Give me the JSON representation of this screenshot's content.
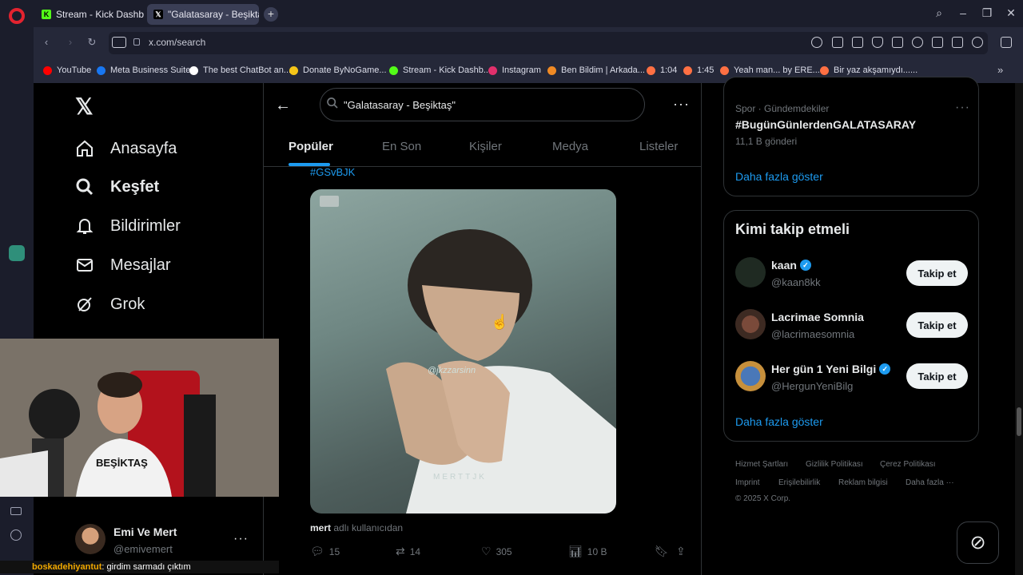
{
  "browser": {
    "tabs": [
      {
        "label": "Stream - Kick Dashboard",
        "icon": "kick-icon"
      },
      {
        "label": "\"Galatasaray - Beşiktaş",
        "icon": "x-icon"
      }
    ],
    "url": "x.com/search",
    "bookmarks": [
      {
        "label": "YouTube",
        "color": "#ff0000"
      },
      {
        "label": "Meta Business Suite",
        "color": "#1877f2"
      },
      {
        "label": "The best ChatBot an...",
        "color": "#ffffff"
      },
      {
        "label": "Donate ByNoGame...",
        "color": "#f5c518"
      },
      {
        "label": "Stream - Kick Dashb...",
        "color": "#53fc18"
      },
      {
        "label": "Instagram",
        "color": "#e1306c"
      },
      {
        "label": "Ben Bildim | Arkada...",
        "color": "#f08a24"
      },
      {
        "label": "1:04",
        "color": "#ff7043"
      },
      {
        "label": "1:45",
        "color": "#ff7043"
      },
      {
        "label": "Yeah man... by ERE...",
        "color": "#ff7043"
      },
      {
        "label": "Bir yaz akşamıydı......",
        "color": "#ff7043"
      }
    ]
  },
  "nav": {
    "items": [
      {
        "label": "Anasayfa",
        "icon": "home-icon"
      },
      {
        "label": "Keşfet",
        "icon": "search-icon"
      },
      {
        "label": "Bildirimler",
        "icon": "bell-icon"
      },
      {
        "label": "Mesajlar",
        "icon": "mail-icon"
      },
      {
        "label": "Grok",
        "icon": "grok-icon"
      }
    ]
  },
  "search": {
    "query": "\"Galatasaray - Beşiktaş\"",
    "tabs": [
      "Popüler",
      "En Son",
      "Kişiler",
      "Medya",
      "Listeler"
    ]
  },
  "post": {
    "hashtag": "#GSvBJK",
    "media_watermark": "MERTTJK",
    "media_tag": "@jkzzarsinn",
    "source_user": "mert",
    "source_suffix": "adlı kullanıcıdan",
    "replies": "15",
    "reposts": "14",
    "likes": "305",
    "views": "10 B"
  },
  "trend": {
    "category": "Spor · Gündemdekiler",
    "name": "#BugünGünlerdenGALATASARAY",
    "count": "11,1 B gönderi",
    "show_more": "Daha fazla göster"
  },
  "who_to_follow": {
    "title": "Kimi takip etmeli",
    "users": [
      {
        "name": "kaan",
        "handle": "@kaan8kk",
        "verified": true,
        "button": "Takip et"
      },
      {
        "name": "Lacrimae Somnia",
        "handle": "@lacrimaesomnia",
        "verified": false,
        "button": "Takip et"
      },
      {
        "name": "Her gün 1 Yeni Bilgi",
        "handle": "@HergunYeniBilg",
        "verified": true,
        "button": "Takip et"
      }
    ],
    "show_more": "Daha fazla göster"
  },
  "footer": {
    "links": [
      "Hizmet Şartları",
      "Gizlilik Politikası",
      "Çerez Politikası",
      "Imprint",
      "Erişilebilirlik",
      "Reklam bilgisi",
      "Daha fazla ···"
    ],
    "copyright": "© 2025 X Corp."
  },
  "account": {
    "name": "Emi Ve Mert",
    "handle": "@emivemert"
  },
  "overlay": {
    "chat_user": "boskadehiyantut",
    "chat_message": ": girdim sarmadı çıktım"
  },
  "colors": {
    "accent": "#1d9bf0",
    "background": "#000000",
    "text": "#e7e9ea",
    "muted": "#71767b"
  }
}
